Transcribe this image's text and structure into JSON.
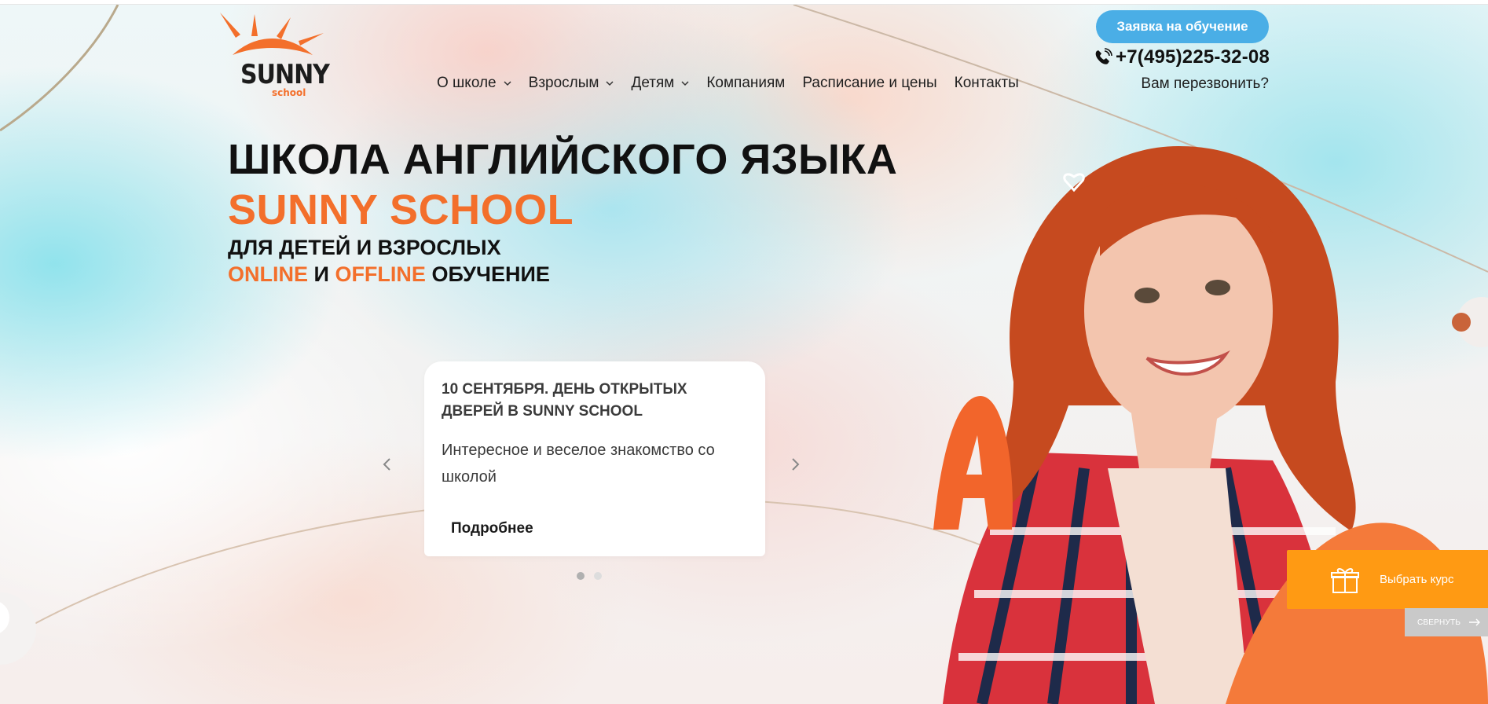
{
  "header": {
    "logo_word": "SUNNY",
    "logo_sub": "school",
    "nav": [
      {
        "label": "О школе",
        "dropdown": true
      },
      {
        "label": "Взрослым",
        "dropdown": true
      },
      {
        "label": "Детям",
        "dropdown": true
      },
      {
        "label": "Компаниям",
        "dropdown": false
      },
      {
        "label": "Расписание и цены",
        "dropdown": false
      },
      {
        "label": "Контакты",
        "dropdown": false
      }
    ],
    "cta_label": "Заявка на обучение",
    "phone": "+7(495)225-32-08",
    "callback_label": "Вам перезвонить?"
  },
  "hero": {
    "title_line1": "ШКОЛА АНГЛИЙСКОГО ЯЗЫКА",
    "title_line2": "SUNNY SCHOOL",
    "subtitle_line1": "ДЛЯ ДЕТЕЙ И ВЗРОСЛЫХ",
    "subtitle_online": "ONLINE",
    "subtitle_and": " И ",
    "subtitle_offline": "OFFLINE",
    "subtitle_end": " ОБУЧЕНИЕ"
  },
  "slider": {
    "card_title": "10 СЕНТЯБРЯ. ДЕНЬ ОТКРЫТЫХ ДВЕРЕЙ В SUNNY SCHOOL",
    "card_text": "Интересное и веселое знакомство со школой",
    "card_more": "Подробнее",
    "current_slide": 1,
    "total_slides": 2
  },
  "widget": {
    "label": "Выбрать курс",
    "collapse_label": "СВЕРНУТЬ"
  },
  "colors": {
    "accent_orange": "#f36f2b",
    "cta_blue": "#4aaee6",
    "widget_orange": "#ff9a13",
    "dot_active": "#b0b0b0",
    "dot_inactive": "#dddddd"
  }
}
